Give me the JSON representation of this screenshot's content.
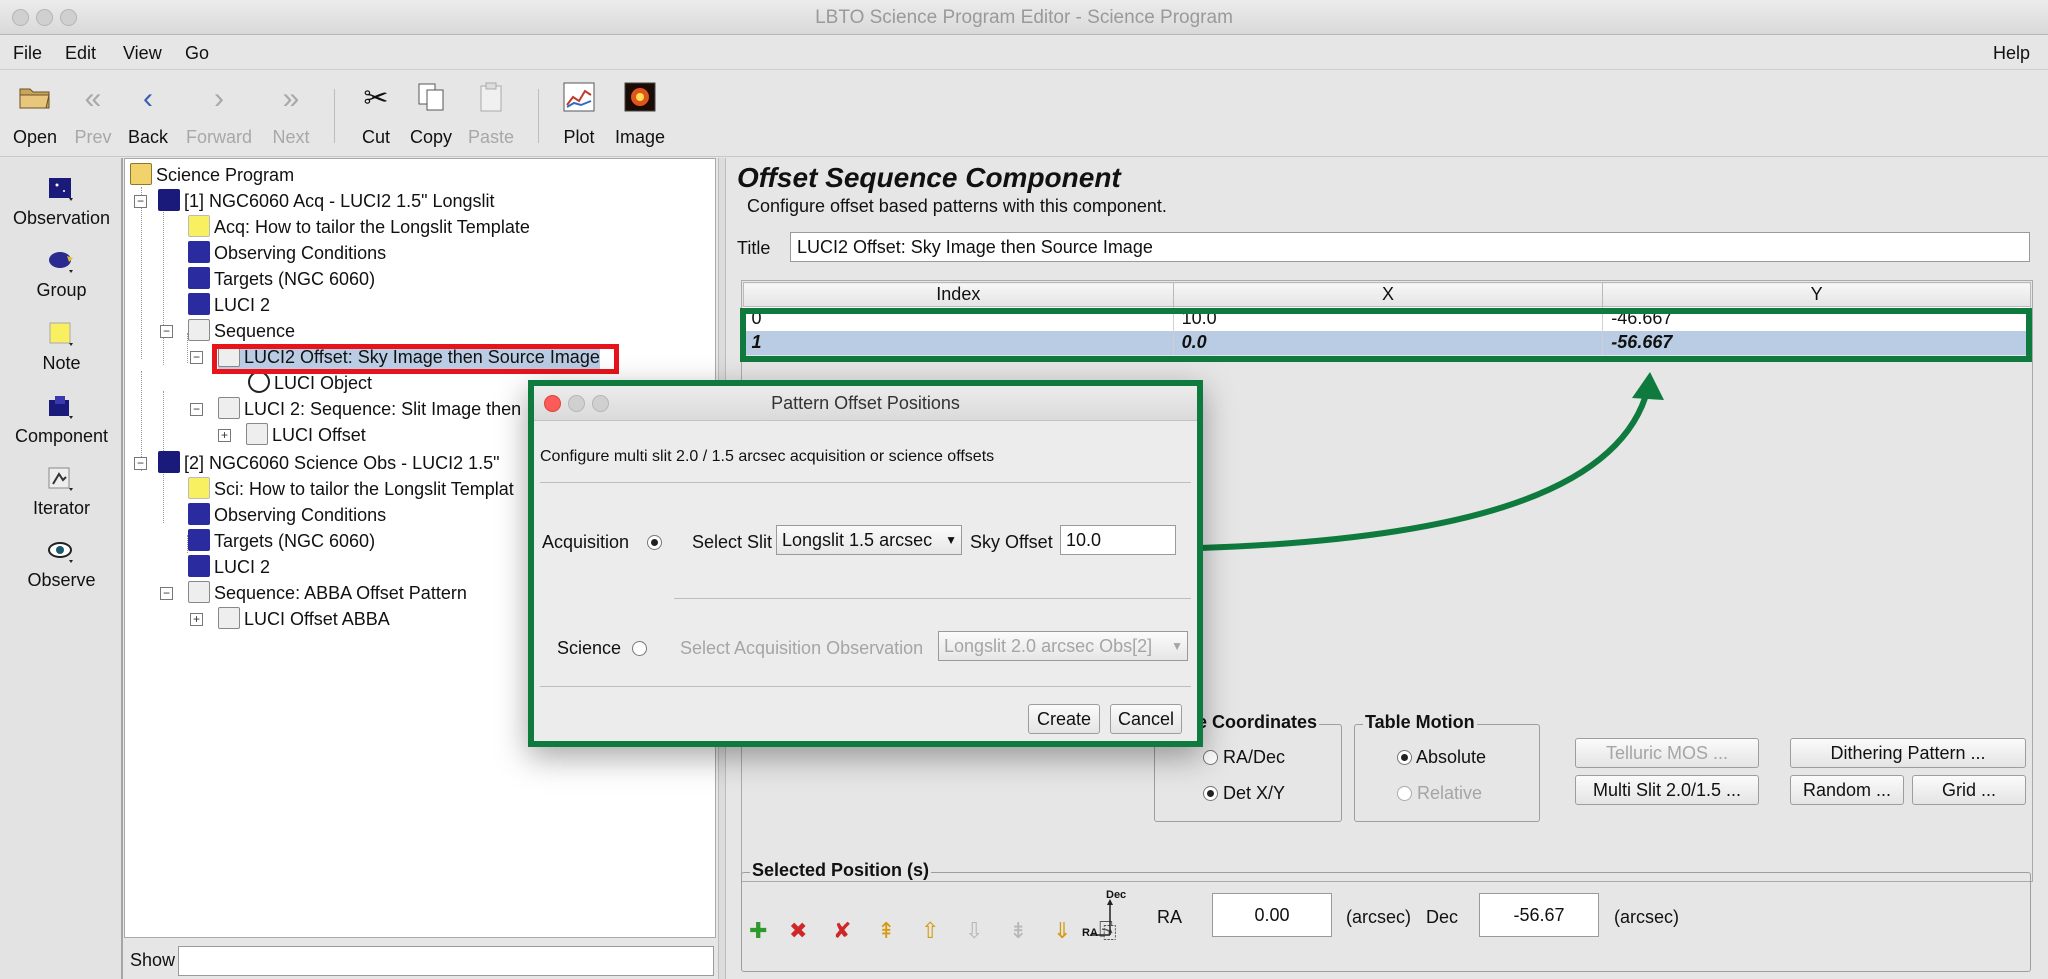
{
  "window": {
    "title": "LBTO Science Program Editor - Science Program"
  },
  "menu": {
    "file": "File",
    "edit": "Edit",
    "view": "View",
    "go": "Go",
    "help": "Help"
  },
  "toolbar": {
    "open": "Open",
    "prev": "Prev",
    "back": "Back",
    "forward": "Forward",
    "next": "Next",
    "cut": "Cut",
    "copy": "Copy",
    "paste": "Paste",
    "plot": "Plot",
    "image": "Image"
  },
  "palette": {
    "observation": "Observation",
    "group": "Group",
    "note": "Note",
    "component": "Component",
    "iterator": "Iterator",
    "observe": "Observe"
  },
  "tree": {
    "root": "Science Program",
    "obs1": "[1] NGC6060 Acq - LUCI2 1.5\" Longslit",
    "acq_note": "Acq: How to tailor the Longslit Template",
    "obs_cond1": "Observing Conditions",
    "targets1": "Targets (NGC 6060)",
    "luci2_1": "LUCI 2",
    "sequence1": "Sequence",
    "offset_sel": "LUCI2 Offset: Sky Image then Source Image",
    "luci_object": "LUCI Object",
    "seq_slit": "LUCI 2: Sequence: Slit Image then",
    "luci_offset": "LUCI Offset",
    "obs2": "[2] NGC6060 Science Obs - LUCI2 1.5\"",
    "sci_note": "Sci: How to tailor the Longslit Templat",
    "obs_cond2": "Observing Conditions",
    "targets2": "Targets (NGC 6060)",
    "luci2_2": "LUCI 2",
    "seq_abba": "Sequence: ABBA Offset Pattern",
    "luci_offset_abba": "LUCI Offset ABBA"
  },
  "show": {
    "label": "Show",
    "value": ""
  },
  "editor": {
    "heading": "Offset Sequence Component",
    "description": "Configure offset based patterns with this component.",
    "title_label": "Title",
    "title_value": "LUCI2 Offset: Sky Image then Source Image",
    "table": {
      "headers": [
        "Index",
        "X",
        "Y"
      ],
      "rows": [
        {
          "index": "0",
          "x": "10.0",
          "y": "-46.667"
        },
        {
          "index": "1",
          "x": "0.0",
          "y": "-56.667"
        }
      ]
    },
    "coordinates": {
      "title": "e Coordinates",
      "radec": "RA/Dec",
      "detxy": "Det X/Y",
      "selected": "Det X/Y"
    },
    "motion": {
      "title": "Table Motion",
      "absolute": "Absolute",
      "relative": "Relative",
      "selected": "Absolute"
    },
    "buttons": {
      "telluric": "Telluric MOS ...",
      "dithering": "Dithering Pattern ...",
      "multislit": "Multi Slit 2.0/1.5 ...",
      "random": "Random ...",
      "grid": "Grid ..."
    },
    "selected_position": {
      "title": "Selected Position (s)",
      "dec_axis": "Dec",
      "ra_axis": "RA",
      "ra_label": "RA",
      "ra_value": "0.00",
      "ra_unit": "(arcsec)",
      "dec_label": "Dec",
      "dec_value": "-56.67",
      "dec_unit": "(arcsec)"
    }
  },
  "dialog": {
    "title": "Pattern Offset Positions",
    "description": "Configure multi slit 2.0 / 1.5 arcsec acquisition or science offsets",
    "acquisition_label": "Acquisition",
    "select_slit_label": "Select Slit",
    "select_slit_value": "Longslit 1.5 arcsec",
    "sky_offset_label": "Sky Offset",
    "sky_offset_value": "10.0",
    "science_label": "Science",
    "select_acq_label": "Select Acquisition Observation",
    "select_acq_value": "Longslit 2.0 arcsec Obs[2]",
    "selected_mode": "Acquisition",
    "create": "Create",
    "cancel": "Cancel"
  },
  "colors": {
    "highlight_red": "#e8141b",
    "highlight_green": "#0f7a3d",
    "selection": "#b9cce4"
  }
}
